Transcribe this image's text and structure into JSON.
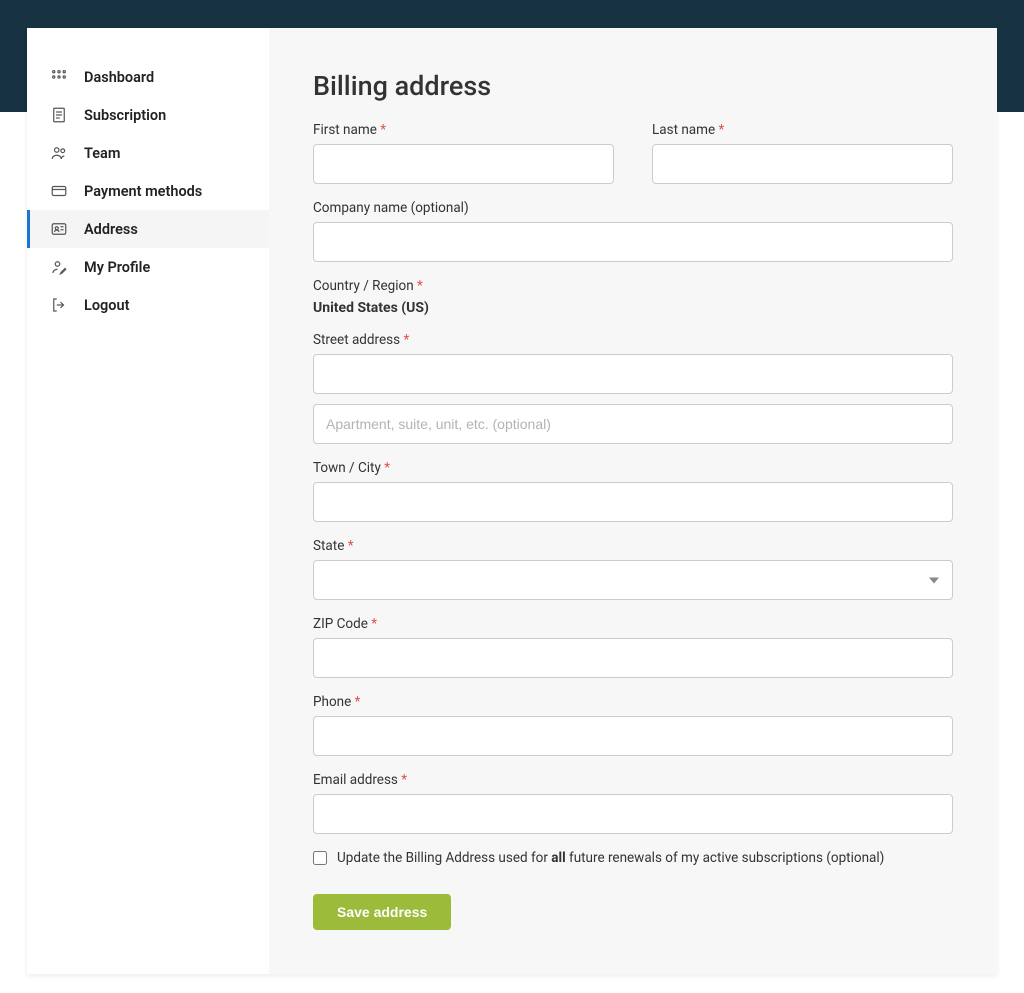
{
  "sidebar": {
    "items": [
      {
        "label": "Dashboard"
      },
      {
        "label": "Subscription"
      },
      {
        "label": "Team"
      },
      {
        "label": "Payment methods"
      },
      {
        "label": "Address"
      },
      {
        "label": "My Profile"
      },
      {
        "label": "Logout"
      }
    ]
  },
  "page": {
    "title": "Billing address"
  },
  "form": {
    "first_name": {
      "label": "First name",
      "required": "*",
      "value": ""
    },
    "last_name": {
      "label": "Last name",
      "required": "*",
      "value": ""
    },
    "company": {
      "label": "Company name (optional)",
      "value": ""
    },
    "country": {
      "label": "Country / Region",
      "required": "*",
      "value": "United States (US)"
    },
    "street": {
      "label": "Street address",
      "required": "*",
      "value": "",
      "placeholder2": "Apartment, suite, unit, etc. (optional)"
    },
    "city": {
      "label": "Town / City",
      "required": "*",
      "value": ""
    },
    "state": {
      "label": "State",
      "required": "*",
      "value": ""
    },
    "zip": {
      "label": "ZIP Code",
      "required": "*",
      "value": ""
    },
    "phone": {
      "label": "Phone",
      "required": "*",
      "value": ""
    },
    "email": {
      "label": "Email address",
      "required": "*",
      "value": ""
    },
    "update_checkbox": {
      "pre": "Update the Billing Address used for ",
      "bold": "all",
      "post": " future renewals of my active subscriptions (optional)",
      "checked": false
    },
    "submit_label": "Save address"
  }
}
